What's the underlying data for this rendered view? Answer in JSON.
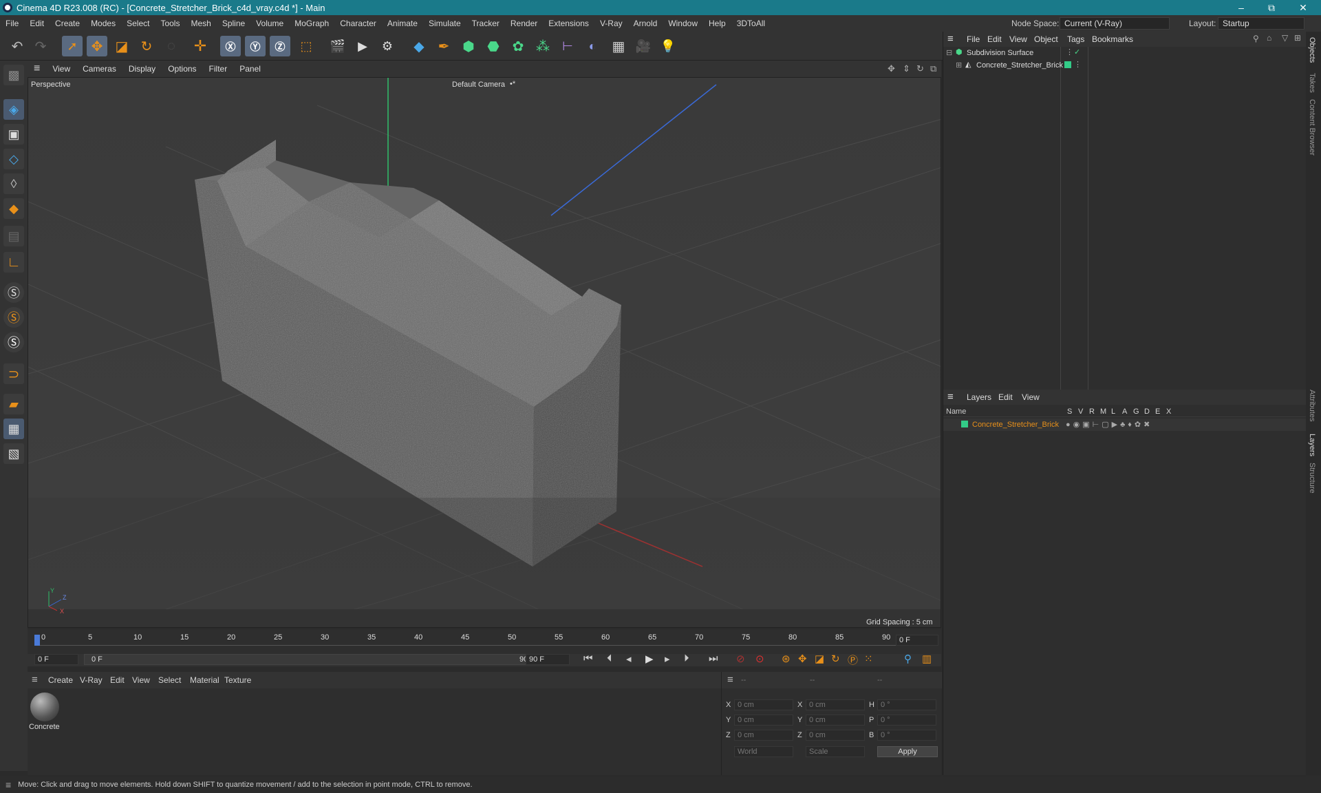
{
  "window": {
    "title": "Cinema 4D R23.008 (RC) - [Concrete_Stretcher_Brick_c4d_vray.c4d *] - Main",
    "min": "–",
    "max": "⧉",
    "close": "✕"
  },
  "menubar": {
    "items": [
      "File",
      "Edit",
      "Create",
      "Modes",
      "Select",
      "Tools",
      "Mesh",
      "Spline",
      "Volume",
      "MoGraph",
      "Character",
      "Animate",
      "Simulate",
      "Tracker",
      "Render",
      "Extensions",
      "V-Ray",
      "Arnold",
      "Window",
      "Help",
      "3DToAll"
    ],
    "node_space_label": "Node Space:",
    "node_space_value": "Current (V-Ray)",
    "layout_label": "Layout:",
    "layout_value": "Startup"
  },
  "viewport": {
    "menu": [
      "View",
      "Cameras",
      "Display",
      "Options",
      "Filter",
      "Panel"
    ],
    "projection": "Perspective",
    "camera": "Default Camera",
    "camera_mark": "•*",
    "grid_spacing": "Grid Spacing : 5 cm",
    "axis_y": "Y",
    "axis_z": "Z",
    "axis_x": "X"
  },
  "timeline": {
    "ticks": [
      "0",
      "5",
      "10",
      "15",
      "20",
      "25",
      "30",
      "35",
      "40",
      "45",
      "50",
      "55",
      "60",
      "65",
      "70",
      "75",
      "80",
      "85",
      "90"
    ],
    "current_frame": "0 F"
  },
  "transport": {
    "start_field": "0 F",
    "range_start": "0 F",
    "range_end": "90 F",
    "end_field": "90 F"
  },
  "material_panel": {
    "menu": [
      "Create",
      "V-Ray",
      "Edit",
      "View",
      "Select",
      "Material",
      "Texture"
    ],
    "material_name": "Concrete"
  },
  "coords": {
    "head": [
      "--",
      "--",
      "--"
    ],
    "rows": [
      {
        "a": "X",
        "av": "0 cm",
        "b": "X",
        "bv": "0 cm",
        "c": "H",
        "cv": "0 °"
      },
      {
        "a": "Y",
        "av": "0 cm",
        "b": "Y",
        "bv": "0 cm",
        "c": "P",
        "cv": "0 °"
      },
      {
        "a": "Z",
        "av": "0 cm",
        "b": "Z",
        "bv": "0 cm",
        "c": "B",
        "cv": "0 °"
      }
    ],
    "mode1": "World",
    "mode2": "Scale",
    "apply": "Apply"
  },
  "objects": {
    "menu": [
      "File",
      "Edit",
      "View",
      "Object",
      "Tags",
      "Bookmarks"
    ],
    "items": [
      {
        "name": "Subdivision Surface"
      },
      {
        "name": "Concrete_Stretcher_Brick"
      }
    ]
  },
  "layers": {
    "menu": [
      "Layers",
      "Edit",
      "View"
    ],
    "name_header": "Name",
    "flags": [
      "S",
      "V",
      "R",
      "M",
      "L",
      "A",
      "G",
      "D",
      "E",
      "X"
    ],
    "layer_name": "Concrete_Stretcher_Brick",
    "layer_color": "#33cc88"
  },
  "side_tabs": [
    "Objects",
    "Takes",
    "Content Browser",
    "Attributes",
    "Layers",
    "Structure"
  ],
  "status": "Move: Click and drag to move elements. Hold down SHIFT to quantize movement / add to the selection in point mode, CTRL to remove.",
  "colors": {
    "accent": "#e8901a",
    "title_bg": "#1a7a8a",
    "layer_text": "#e8901a"
  }
}
